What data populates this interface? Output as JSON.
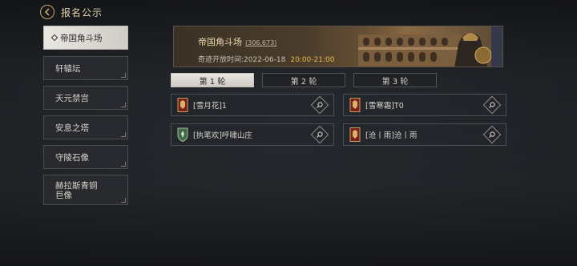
{
  "header": {
    "title": "报名公示",
    "back_icon": "back-arrow-icon"
  },
  "sidebar": {
    "items": [
      {
        "label": "帝国角斗场",
        "active": true
      },
      {
        "label": "轩辕坛",
        "active": false
      },
      {
        "label": "天元禁宫",
        "active": false
      },
      {
        "label": "安息之塔",
        "active": false
      },
      {
        "label": "守陵石像",
        "active": false
      },
      {
        "label": "赫拉斯青铜巨像",
        "active": false
      }
    ]
  },
  "banner": {
    "title": "帝国角斗场",
    "count": "(306,673)",
    "time_label": "奇迹开放时间:2022-06-18",
    "hours": "20:00-21:00"
  },
  "rounds": [
    {
      "label": "第 1 轮",
      "active": true
    },
    {
      "label": "第 2 轮",
      "active": false
    },
    {
      "label": "第 3 轮",
      "active": false
    }
  ],
  "entries": [
    {
      "name": "[雪月花]1",
      "emblem": "red-banner-icon"
    },
    {
      "name": "[雪寒霜]T0",
      "emblem": "red-banner-icon"
    },
    {
      "name": "[执笔欢]呼啸山庄",
      "emblem": "green-shield-icon"
    },
    {
      "name": "[沧丨雨]沧丨雨",
      "emblem": "red-banner-icon"
    }
  ],
  "colors": {
    "accent": "#e9b94f",
    "gold": "#c9a76a",
    "active_bg": "#e8e6e1"
  }
}
